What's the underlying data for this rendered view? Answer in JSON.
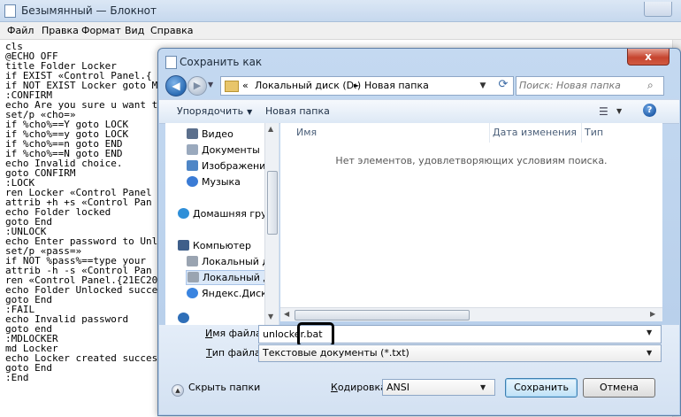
{
  "notepad": {
    "title": "Безымянный — Блокнот",
    "menu": [
      "Файл",
      "Правка",
      "Формат",
      "Вид",
      "Справка"
    ],
    "lines": [
      "cls",
      "@ECHO OFF",
      "title Folder Locker",
      "if EXIST «Control Panel.{",
      "if NOT EXIST Locker goto M",
      ":CONFIRM",
      "echo Are you sure u want t",
      "set/p «cho=»",
      "if %cho%==Y goto LOCK",
      "if %cho%==y goto LOCK",
      "if %cho%==n goto END",
      "if %cho%==N goto END",
      "echo Invalid choice.",
      "goto CONFIRM",
      ":LOCK",
      "ren Locker «Control Panel",
      "attrib +h +s «Control Pan",
      "echo Folder locked",
      "goto End",
      ":UNLOCK",
      "echo Enter password to Unl",
      "set/p «pass=»",
      "if NOT %pass%==type your",
      "attrib -h -s «Control Pan",
      "ren «Control Panel.{21EC20",
      "echo Folder Unlocked succe",
      "goto End",
      ":FAIL",
      "echo Invalid password",
      "goto end",
      ":MDLOCKER",
      "md Locker",
      "echo Locker created succes",
      "goto End",
      ":End"
    ]
  },
  "dialog": {
    "title": "Сохранить как",
    "close_label": "x",
    "breadcrumb": [
      "«",
      "Локальный диск (D:)",
      "►",
      "Новая папка"
    ],
    "search_placeholder": "Поиск: Новая папка",
    "toolbar": {
      "organize": "Упорядочить",
      "new_folder": "Новая папка"
    },
    "nav_items": [
      {
        "label": "Видео",
        "icon": "video-library-icon",
        "color": "#5b6f8c"
      },
      {
        "label": "Документы",
        "icon": "documents-library-icon",
        "color": "#9aa9bd"
      },
      {
        "label": "Изображения",
        "icon": "pictures-library-icon",
        "color": "#4f86c6"
      },
      {
        "label": "Музыка",
        "icon": "music-library-icon",
        "color": "#3a7bd5"
      },
      {
        "label": "Домашняя группа",
        "icon": "homegroup-icon",
        "color": "#2f8fd8"
      },
      {
        "label": "Компьютер",
        "icon": "computer-icon",
        "color": "#3f5f8a"
      },
      {
        "label": "Локальный диск",
        "icon": "drive-icon",
        "color": "#9aa4b1"
      },
      {
        "label": "Локальный диск",
        "icon": "drive-icon",
        "color": "#9aa4b1"
      },
      {
        "label": "Яндекс.Диск",
        "icon": "yandex-disk-icon",
        "color": "#3a84e0"
      }
    ],
    "columns": [
      "Имя",
      "Дата изменения",
      "Тип"
    ],
    "empty_message": "Нет элементов, удовлетворяющих условиям поиска.",
    "file_name_label_underlined": "И",
    "file_name_label_rest": "мя файла:",
    "file_name_value": "unlocker.bat",
    "file_type_label_underlined": "Т",
    "file_type_label_rest": "ип файла:",
    "file_type_value": "Текстовые документы (*.txt)",
    "hide_folders": "Скрыть папки",
    "encoding_label_underlined": "К",
    "encoding_label_rest": "одировка:",
    "encoding_value": "ANSI",
    "save_button": "Сохранить",
    "cancel_button": "Отмена"
  }
}
